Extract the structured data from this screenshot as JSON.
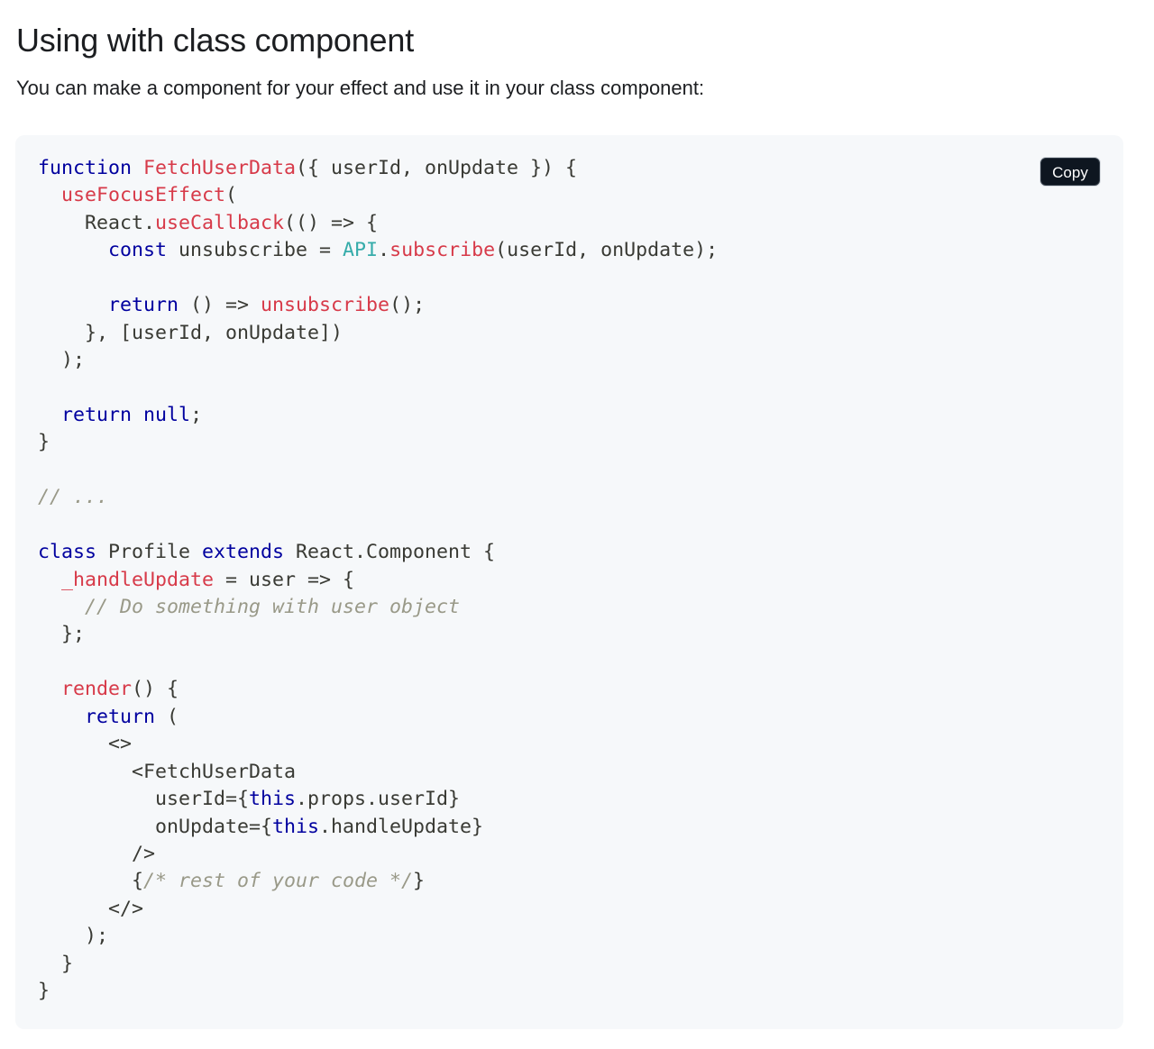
{
  "page": {
    "heading": "Using with class component",
    "intro": "You can make a component for your effect and use it in your class component:"
  },
  "code_block": {
    "copy_label": "Copy",
    "language": "jsx",
    "colors": {
      "background": "#f6f8fa",
      "keyword": "#00009f",
      "function": "#d73a49",
      "builtin": "#36acaa",
      "comment": "#999988",
      "plain": "#393a34",
      "copy_button_bg": "#0e1620"
    },
    "lines": [
      [
        [
          "keyword",
          "function"
        ],
        [
          "plain",
          " "
        ],
        [
          "function",
          "FetchUserData"
        ],
        [
          "plain",
          "({ userId, onUpdate }) {"
        ]
      ],
      [
        [
          "plain",
          "  "
        ],
        [
          "function",
          "useFocusEffect"
        ],
        [
          "plain",
          "("
        ]
      ],
      [
        [
          "plain",
          "    React."
        ],
        [
          "function",
          "useCallback"
        ],
        [
          "plain",
          "(() => {"
        ]
      ],
      [
        [
          "plain",
          "      "
        ],
        [
          "keyword",
          "const"
        ],
        [
          "plain",
          " unsubscribe = "
        ],
        [
          "builtin",
          "API"
        ],
        [
          "plain",
          "."
        ],
        [
          "function",
          "subscribe"
        ],
        [
          "plain",
          "(userId, onUpdate);"
        ]
      ],
      [],
      [
        [
          "plain",
          "      "
        ],
        [
          "keyword",
          "return"
        ],
        [
          "plain",
          " () => "
        ],
        [
          "function",
          "unsubscribe"
        ],
        [
          "plain",
          "();"
        ]
      ],
      [
        [
          "plain",
          "    }, [userId, onUpdate])"
        ]
      ],
      [
        [
          "plain",
          "  );"
        ]
      ],
      [],
      [
        [
          "plain",
          "  "
        ],
        [
          "keyword",
          "return"
        ],
        [
          "plain",
          " "
        ],
        [
          "keyword",
          "null"
        ],
        [
          "plain",
          ";"
        ]
      ],
      [
        [
          "plain",
          "}"
        ]
      ],
      [],
      [
        [
          "comment",
          "// ..."
        ]
      ],
      [],
      [
        [
          "keyword",
          "class"
        ],
        [
          "plain",
          " Profile "
        ],
        [
          "keyword",
          "extends"
        ],
        [
          "plain",
          " React.Component {"
        ]
      ],
      [
        [
          "plain",
          "  "
        ],
        [
          "function",
          "_handleUpdate"
        ],
        [
          "plain",
          " = user => {"
        ]
      ],
      [
        [
          "plain",
          "    "
        ],
        [
          "comment",
          "// Do something with user object"
        ]
      ],
      [
        [
          "plain",
          "  };"
        ]
      ],
      [],
      [
        [
          "plain",
          "  "
        ],
        [
          "function",
          "render"
        ],
        [
          "plain",
          "() {"
        ]
      ],
      [
        [
          "plain",
          "    "
        ],
        [
          "keyword",
          "return"
        ],
        [
          "plain",
          " ("
        ]
      ],
      [
        [
          "plain",
          "      <>"
        ]
      ],
      [
        [
          "plain",
          "        <FetchUserData"
        ]
      ],
      [
        [
          "plain",
          "          userId={"
        ],
        [
          "keyword",
          "this"
        ],
        [
          "plain",
          ".props.userId}"
        ]
      ],
      [
        [
          "plain",
          "          onUpdate={"
        ],
        [
          "keyword",
          "this"
        ],
        [
          "plain",
          ".handleUpdate}"
        ]
      ],
      [
        [
          "plain",
          "        />"
        ]
      ],
      [
        [
          "plain",
          "        {"
        ],
        [
          "comment",
          "/* rest of your code */"
        ],
        [
          "plain",
          "}"
        ]
      ],
      [
        [
          "plain",
          "      </>"
        ]
      ],
      [
        [
          "plain",
          "    );"
        ]
      ],
      [
        [
          "plain",
          "  }"
        ]
      ],
      [
        [
          "plain",
          "}"
        ]
      ]
    ]
  }
}
